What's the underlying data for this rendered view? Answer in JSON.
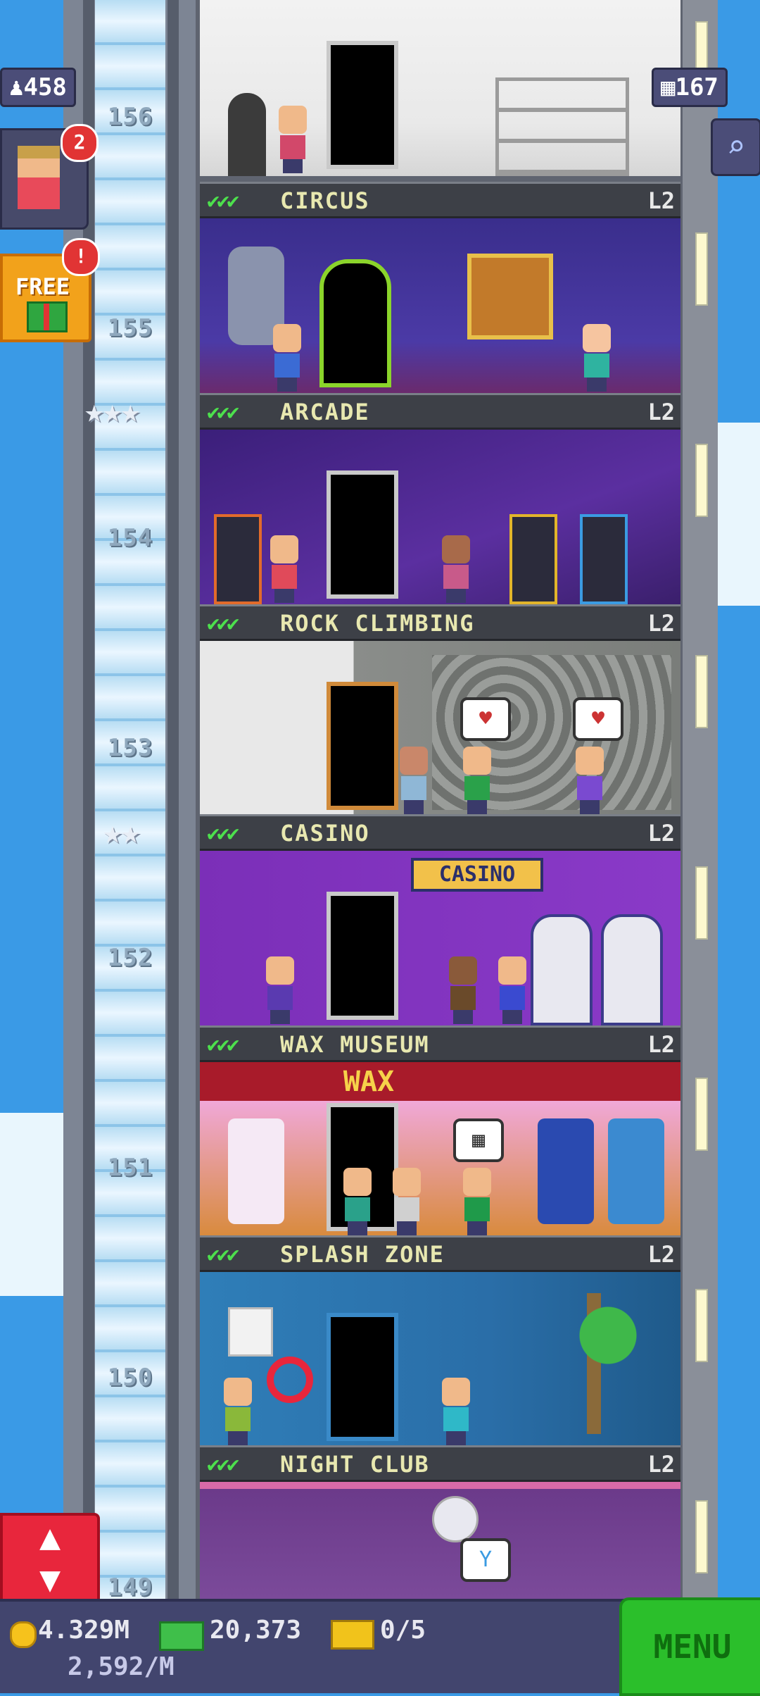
{
  "hud": {
    "population": "458",
    "floors": "167",
    "visitor_badge": "2",
    "free_badge": "!",
    "free_label": "FREE"
  },
  "elevator": {
    "floor_numbers": [
      "156",
      "155",
      "154",
      "153",
      "152",
      "151",
      "150",
      "149"
    ]
  },
  "rooms": [
    {
      "name": "CIRCUS",
      "level": "L2",
      "checks": "✔✔✔"
    },
    {
      "name": "ARCADE",
      "level": "L2",
      "checks": "✔✔✔"
    },
    {
      "name": "ROCK CLIMBING",
      "level": "L2",
      "checks": "✔✔✔"
    },
    {
      "name": "CASINO",
      "level": "L2",
      "checks": "✔✔✔"
    },
    {
      "name": "WAX MUSEUM",
      "level": "L2",
      "checks": "✔✔✔"
    },
    {
      "name": "SPLASH ZONE",
      "level": "L2",
      "checks": "✔✔✔"
    },
    {
      "name": "NIGHT CLUB",
      "level": "L2",
      "checks": "✔✔✔"
    }
  ],
  "signs": {
    "casino": "CASINO",
    "wax": "WAX"
  },
  "stars": {
    "arcade_shaft": "★★★",
    "casino_shaft": "★★"
  },
  "bottom_bar": {
    "coins": "4.329M",
    "bux": "20,373",
    "tickets": "0/5",
    "income": "2,592/M",
    "menu_label": "MENU"
  },
  "colors": {
    "sky": "#3a9ae6",
    "menu": "#2bbf2b",
    "elevator_button": "#e8263c"
  }
}
